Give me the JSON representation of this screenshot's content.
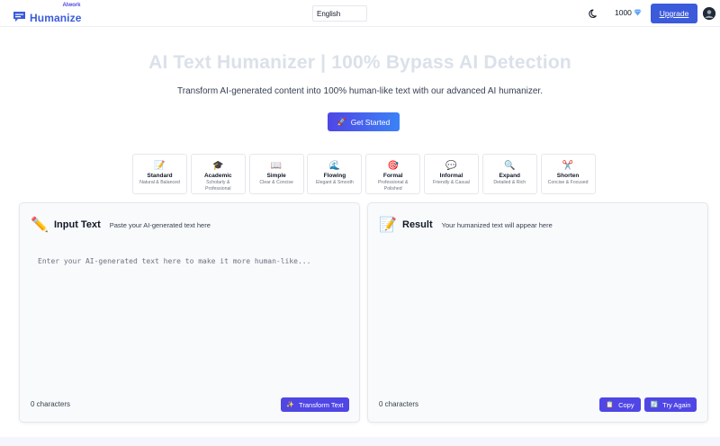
{
  "header": {
    "brand_small": "AIwork",
    "brand_main": "Humanize",
    "language": "English",
    "credits": "1000",
    "upgrade_label": "Upgrade",
    "icons": {
      "logo": "chat-bubble-icon",
      "theme": "moon-icon",
      "credits": "diamond-icon",
      "user": "user-avatar-icon"
    }
  },
  "hero": {
    "title_a": "AI Text Humanizer | 100% Bypass AI Detection",
    "subtitle": "Transform AI-generated content into 100% human-like text with our advanced AI humanizer.",
    "cta_icon": "🚀",
    "cta_label": "Get Started"
  },
  "modes": [
    {
      "icon": "📝",
      "name": "Standard",
      "desc": "Natural & Balanced"
    },
    {
      "icon": "🎓",
      "name": "Academic",
      "desc": "Scholarly & Professional"
    },
    {
      "icon": "📖",
      "name": "Simple",
      "desc": "Clear & Concise"
    },
    {
      "icon": "🌊",
      "name": "Flowing",
      "desc": "Elegant & Smooth"
    },
    {
      "icon": "🎯",
      "name": "Formal",
      "desc": "Professional & Polished"
    },
    {
      "icon": "💬",
      "name": "Informal",
      "desc": "Friendly & Casual"
    },
    {
      "icon": "🔍",
      "name": "Expand",
      "desc": "Detailed & Rich"
    },
    {
      "icon": "✂️",
      "name": "Shorten",
      "desc": "Concise & Focused"
    }
  ],
  "input_panel": {
    "icon": "✏️",
    "title": "Input Text",
    "subtitle": "Paste your AI-generated text here",
    "placeholder": "Enter your AI-generated text here to make it more human-like...",
    "char_count": "0 characters",
    "transform_icon": "✨",
    "transform_label": "Transform Text"
  },
  "result_panel": {
    "icon": "📝",
    "title": "Result",
    "subtitle": "Your humanized text will appear here",
    "char_count": "0 characters",
    "copy_icon": "📋",
    "copy_label": "Copy",
    "again_icon": "🔄",
    "again_label": "Try Again"
  },
  "colors": {
    "brand": "#3b5bdb",
    "button": "#4f46e5",
    "panel_bg": "#f9fafb"
  }
}
